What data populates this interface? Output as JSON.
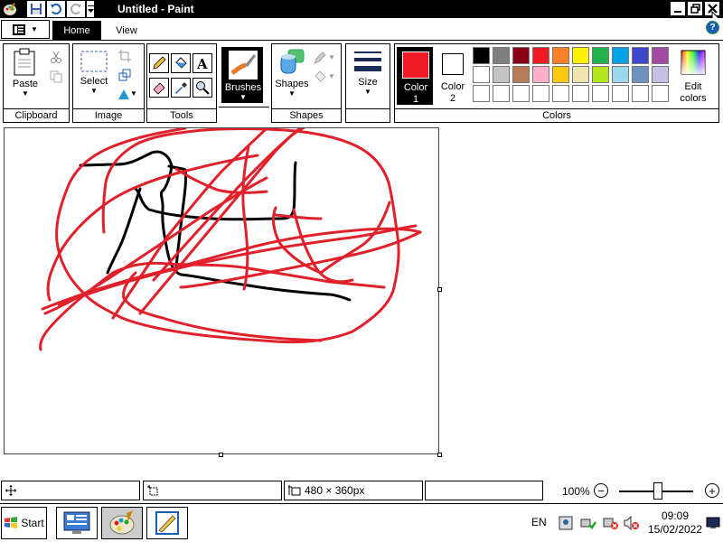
{
  "window": {
    "title": "Untitled - Paint",
    "controls": [
      "minimize",
      "restore",
      "close"
    ]
  },
  "quick_access": [
    "paint-app-icon",
    "save-icon",
    "undo-icon",
    "redo-icon",
    "customize-dropdown"
  ],
  "ribbon": {
    "tabs": [
      {
        "label": "Home",
        "active": true
      },
      {
        "label": "View",
        "active": false
      }
    ],
    "groups": {
      "clipboard": {
        "label": "Clipboard",
        "paste_label": "Paste"
      },
      "image": {
        "label": "Image",
        "select_label": "Select"
      },
      "tools": {
        "label": "Tools"
      },
      "brushes": {
        "label": "Brushes"
      },
      "shapes": {
        "label": "Shapes",
        "shapes_label": "Shapes"
      },
      "size": {
        "label": "Size"
      },
      "colors": {
        "label": "Colors",
        "color1_line1": "Color",
        "color1_line2": "1",
        "color2_line1": "Color",
        "color2_line2": "2",
        "edit_line1": "Edit",
        "edit_line2": "colors",
        "color1_value": "#ed1c24",
        "color2_value": "#ffffff",
        "palette_row1": [
          "#000000",
          "#7f7f7f",
          "#880015",
          "#ed1c24",
          "#ff7f27",
          "#fff200",
          "#22b14c",
          "#00a2e8",
          "#3f48cc",
          "#a349a4"
        ],
        "palette_row2": [
          "#ffffff",
          "#c3c3c3",
          "#b97a57",
          "#ffaec9",
          "#ffc90e",
          "#efe4b0",
          "#b5e61d",
          "#99d9ea",
          "#7092be",
          "#c8bfe7"
        ],
        "palette_row3": [
          "#ffffff",
          "#ffffff",
          "#ffffff",
          "#ffffff",
          "#ffffff",
          "#ffffff",
          "#ffffff",
          "#ffffff",
          "#ffffff",
          "#ffffff"
        ]
      }
    }
  },
  "status": {
    "size_text": "480 × 360px",
    "zoom": "100%",
    "zoom_minus": "−",
    "zoom_plus": "+"
  },
  "taskbar": {
    "start_label": "Start",
    "lang": "EN",
    "time": "09:09",
    "date": "15/02/2022"
  },
  "colors": {
    "stroke_red": "#e0202a",
    "stroke_black": "#000000",
    "accent_blue": "#1a5fb4"
  }
}
